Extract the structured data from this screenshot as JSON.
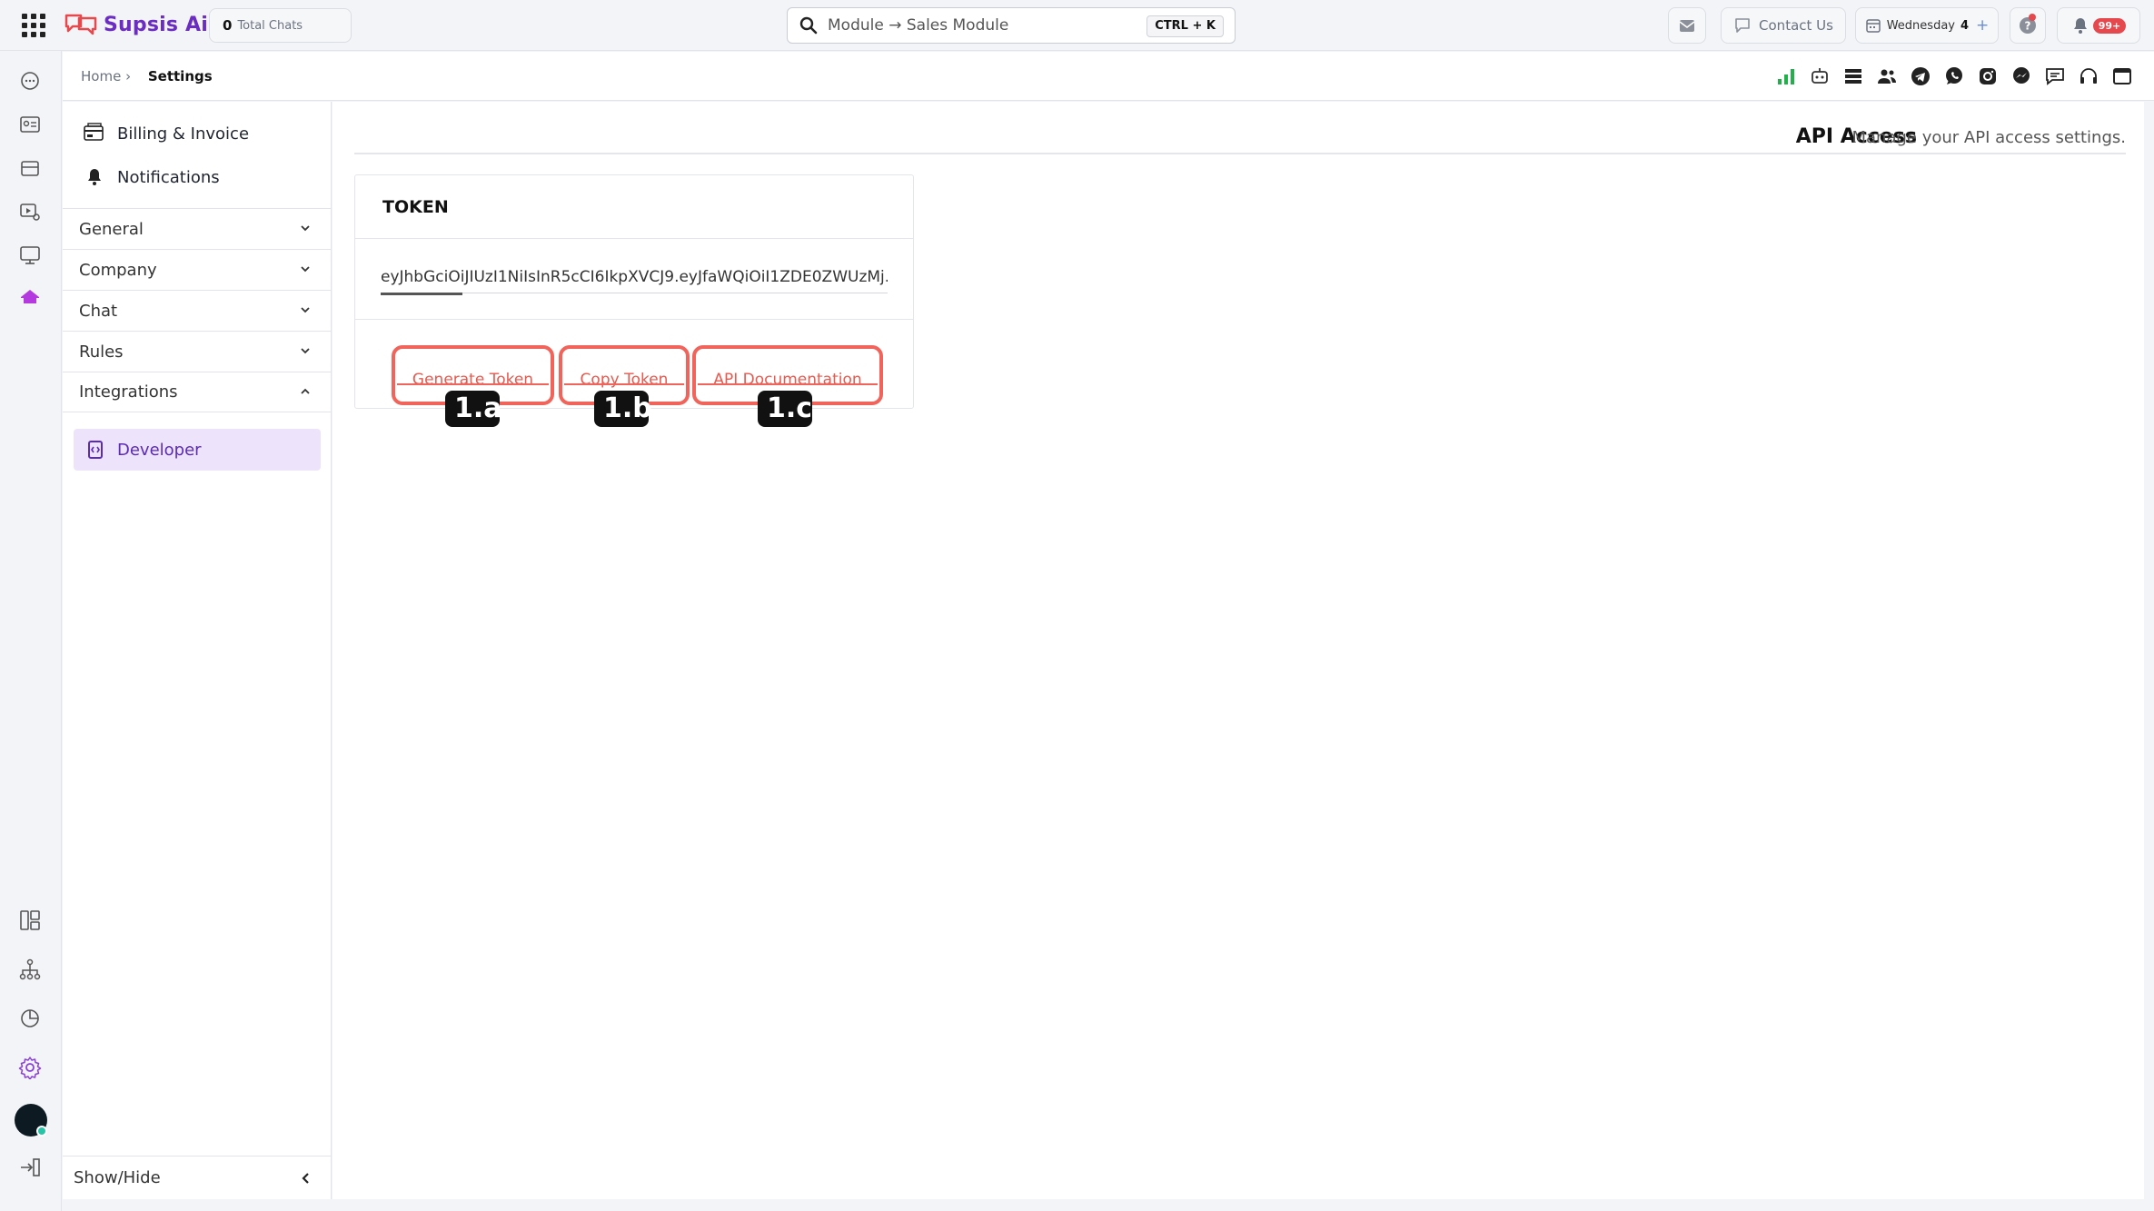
{
  "app": {
    "logo_text": "Supsis Ai",
    "total_chats_count": "0",
    "total_chats_label": "Total Chats"
  },
  "search": {
    "value": "Module → Sales Module",
    "shortcut": "CTRL + K"
  },
  "topbar": {
    "contact_label": "Contact Us",
    "day_label": "Wednesday",
    "day_number": "4",
    "notif_badge": "99+"
  },
  "breadcrumb": {
    "home": "Home ›",
    "current": "Settings"
  },
  "sidebar": {
    "links": [
      {
        "label": "Billing & Invoice",
        "icon": "billing-icon"
      },
      {
        "label": "Notifications",
        "icon": "bell-icon"
      }
    ],
    "sections": [
      {
        "label": "General",
        "expanded": false
      },
      {
        "label": "Company",
        "expanded": false
      },
      {
        "label": "Chat",
        "expanded": false
      },
      {
        "label": "Rules",
        "expanded": false
      },
      {
        "label": "Integrations",
        "expanded": true
      }
    ],
    "active_item": "Developer",
    "toggle_label": "Show/Hide"
  },
  "page": {
    "title": "API Access",
    "subtitle": "Manage your API access settings."
  },
  "token": {
    "heading": "TOKEN",
    "value": "eyJhbGciOiJIUzI1NiIsInR5cCI6IkpXVCJ9.eyJfaWQiOiI1ZDE0ZWUzMj..."
  },
  "actions": {
    "generate": "Generate Token",
    "copy": "Copy Token",
    "docs": "API Documentation"
  },
  "markers": [
    "1.a",
    "1.b",
    "1.c"
  ],
  "colors": {
    "brand": "#6a2cc1",
    "accent_red": "#f0645b",
    "active_bg": "#ede4fb"
  }
}
